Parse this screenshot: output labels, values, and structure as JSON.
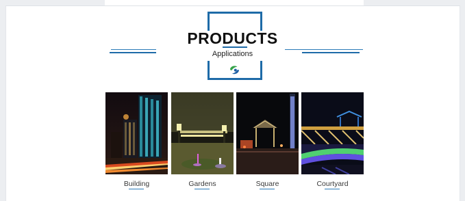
{
  "header": {
    "title": "PRODUCTS",
    "subtitle": "Applications",
    "logo_icon": "green-leaf-logo-icon",
    "accent_color": "#1e6ba8"
  },
  "applications": [
    {
      "label": "Building",
      "image": "night-building-facade-photo"
    },
    {
      "label": "Gardens",
      "image": "garden-lamps-fountain-photo"
    },
    {
      "label": "Square",
      "image": "square-pavilion-lights-photo"
    },
    {
      "label": "Courtyard",
      "image": "courtyard-bridge-lights-photo"
    }
  ]
}
